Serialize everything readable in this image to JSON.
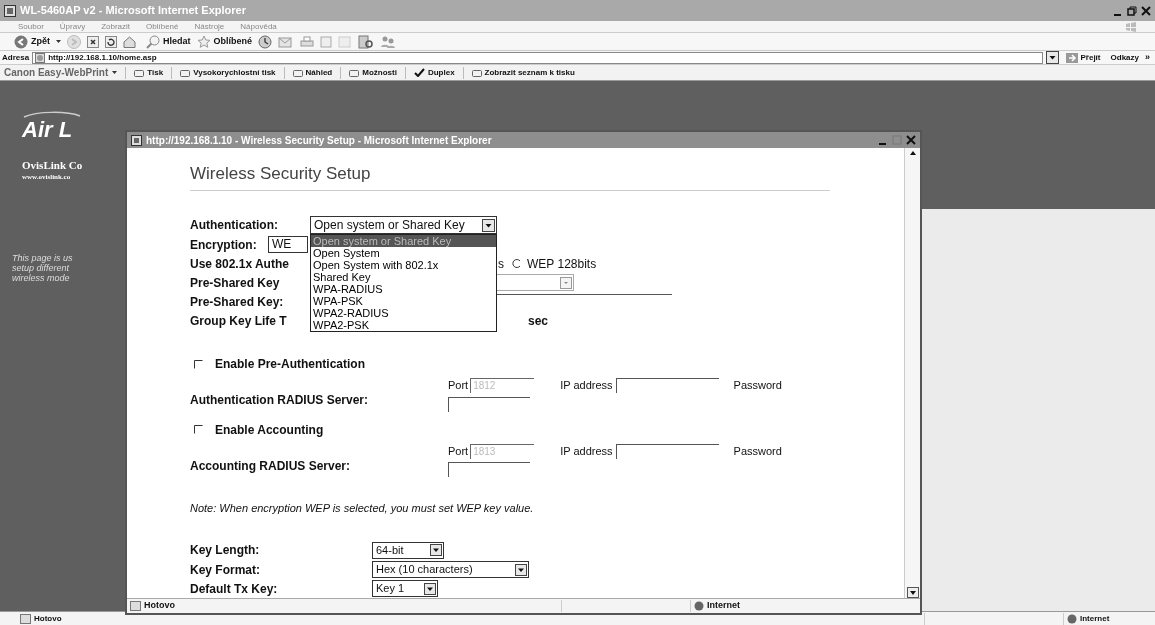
{
  "window": {
    "title": "WL-5460AP v2 - Microsoft Internet Explorer"
  },
  "menu": [
    "Soubor",
    "Úpravy",
    "Zobrazit",
    "Oblíbené",
    "Nástroje",
    "Nápověda"
  ],
  "toolbar": {
    "back": "Zpět",
    "search": "Hledat",
    "favorites": "Oblíbené"
  },
  "address": {
    "label": "Adresa",
    "value": "http://192.168.1.10/home.asp",
    "go": "Přejít",
    "links": "Odkazy",
    "more": "»"
  },
  "print_toolbar": {
    "brand": "Canon Easy-WebPrint",
    "items": [
      {
        "label": "Tisk",
        "kind": "button"
      },
      {
        "label": "Vysokorychlostní tisk",
        "kind": "button"
      },
      {
        "label": "Náhled",
        "kind": "button"
      },
      {
        "label": "Možnosti",
        "kind": "button"
      },
      {
        "label": "Duplex",
        "kind": "toggle",
        "checked": true
      },
      {
        "label": "Zobrazit seznam k tisku",
        "kind": "button"
      }
    ]
  },
  "background_page": {
    "logo": "Air L",
    "company": "OvisLink Co",
    "url": "www.ovislink.co",
    "description": [
      "This page is us",
      "setup different",
      "wireless mode"
    ]
  },
  "popup": {
    "title": "http://192.168.1.10 - Wireless Security Setup - Microsoft Internet Explorer",
    "heading": "Wireless Security Setup",
    "authentication": {
      "label": "Authentication:",
      "value": "Open system or Shared Key",
      "options": [
        {
          "label": "Open system or Shared Key",
          "selected": true
        },
        {
          "label": "Open System",
          "selected": false
        },
        {
          "label": "Open System with 802.1x",
          "selected": false
        },
        {
          "label": "Shared Key",
          "selected": false
        },
        {
          "label": "WPA-RADIUS",
          "selected": false
        },
        {
          "label": "WPA-PSK",
          "selected": false
        },
        {
          "label": "WPA2-RADIUS",
          "selected": false
        },
        {
          "label": "WPA2-PSK",
          "selected": false
        }
      ]
    },
    "encryption": {
      "label": "Encryption:",
      "value": "WE"
    },
    "use_8021x": {
      "label": "Use 802.1x Authe",
      "tail": "s",
      "radio_label": "WEP 128bits",
      "radio_selected": false
    },
    "psk_type": {
      "label": "Pre-Shared Key"
    },
    "psk": {
      "label": "Pre-Shared Key:"
    },
    "group_key": {
      "label": "Group Key Life T",
      "unit": "sec"
    },
    "pre_auth": {
      "label": "Enable Pre-Authentication",
      "checked": false
    },
    "auth_radius": {
      "label": "Authentication RADIUS Server:",
      "port_label": "Port",
      "port": "1812",
      "port_disabled": true,
      "ip_label": "IP address",
      "password_label": "Password"
    },
    "accounting": {
      "label": "Enable Accounting",
      "checked": false
    },
    "acct_radius": {
      "label": "Accounting RADIUS Server:",
      "port_label": "Port",
      "port": "1813",
      "port_disabled": true,
      "ip_label": "IP address",
      "password_label": "Password"
    },
    "note": "Note: When encryption WEP is selected, you must set WEP key value.",
    "key_length": {
      "label": "Key Length:",
      "value": "64-bit"
    },
    "key_format": {
      "label": "Key Format:",
      "value": "Hex (10 characters)"
    },
    "default_tx_key": {
      "label": "Default Tx Key:",
      "value": "Key 1"
    },
    "status": {
      "text": "Hotovo",
      "zone": "Internet"
    }
  },
  "status_bar": {
    "text": "Hotovo",
    "zone": "Internet"
  }
}
